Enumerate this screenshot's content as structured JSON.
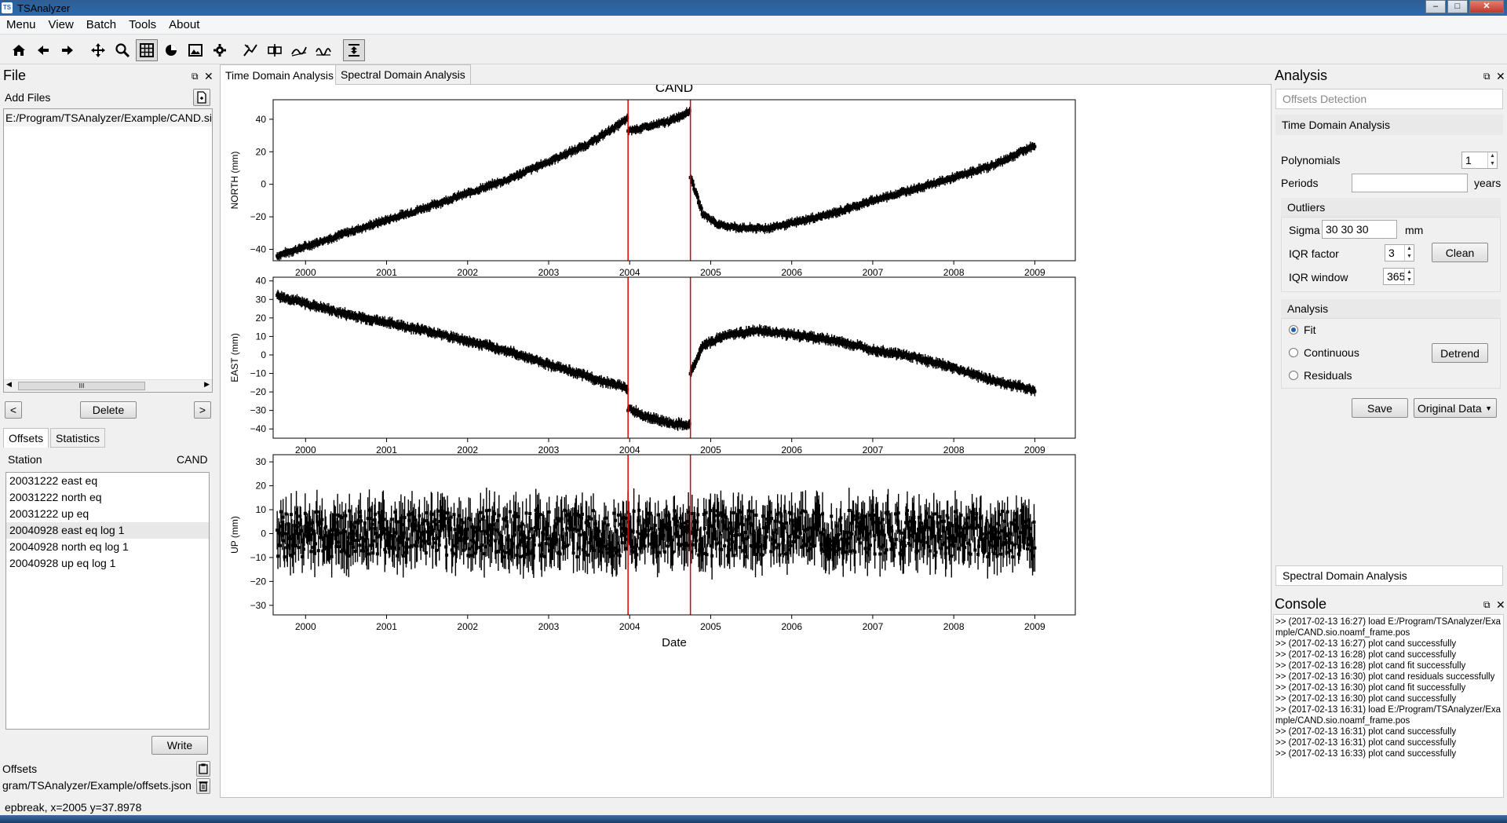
{
  "window": {
    "title": "TSAnalyzer",
    "app_icon": "TS"
  },
  "menubar": [
    "Menu",
    "View",
    "Batch",
    "Tools",
    "About"
  ],
  "toolbar": [
    "home-icon",
    "back-arrow-icon",
    "forward-arrow-icon",
    "pan-icon",
    "zoom-icon",
    "grid-icon",
    "pie-icon",
    "image-icon",
    "gear-icon",
    "remove-outliers-icon",
    "offset-icon",
    "fit-icon",
    "residual-icon",
    "export-icon"
  ],
  "file_panel": {
    "title": "File",
    "add_files_label": "Add Files",
    "file_path": "E:/Program/TSAnalyzer/Example/CAND.sio",
    "scroll_marker": "III",
    "delete_label": "Delete",
    "prev_label": "<",
    "next_label": ">"
  },
  "offsets_panel": {
    "tabs": [
      "Offsets",
      "Statistics"
    ],
    "station_label": "Station",
    "station_value": "CAND",
    "items": [
      "20031222 east eq",
      "20031222 north eq",
      "20031222 up eq",
      "20040928 east eq log 1",
      "20040928 north eq log 1",
      "20040928 up eq log 1"
    ],
    "selected_index": 3,
    "write_label": "Write",
    "offsets_file_label": "Offsets",
    "offsets_file_path": "gram/TSAnalyzer/Example/offsets.json"
  },
  "center": {
    "tabs": [
      "Time Domain Analysis",
      "Spectral Domain Analysis"
    ],
    "active_tab": 0
  },
  "chart_data": [
    {
      "type": "scatter",
      "title": "CAND",
      "ylabel": "NORTH (mm)",
      "xlabel": "",
      "xlim": [
        1999.6,
        2009.5
      ],
      "ylim": [
        -47,
        52
      ],
      "yticks": [
        -40,
        -20,
        0,
        20,
        40
      ],
      "xticks": [
        2000,
        2001,
        2002,
        2003,
        2004,
        2005,
        2006,
        2007,
        2008,
        2009
      ],
      "offset_lines": [
        2003.98,
        2004.75
      ],
      "segments": [
        {
          "x": [
            1999.65,
            2000.5,
            2001.5,
            2002.5,
            2003.5,
            2003.97
          ],
          "y": [
            -44,
            -30,
            -14,
            3,
            25,
            40
          ]
        },
        {
          "x": [
            2003.98,
            2004.2,
            2004.5,
            2004.74
          ],
          "y": [
            33,
            35,
            39,
            45
          ]
        },
        {
          "x": [
            2004.75,
            2004.9,
            2005.1,
            2005.4,
            2005.7,
            2006.0,
            2006.5,
            2007.0,
            2007.5,
            2008.0,
            2008.5,
            2009.0
          ],
          "y": [
            5,
            -18,
            -25,
            -27,
            -27,
            -24,
            -18,
            -10,
            -3,
            4,
            12,
            24
          ]
        }
      ]
    },
    {
      "type": "scatter",
      "title": "",
      "ylabel": "EAST (mm)",
      "xlabel": "",
      "xlim": [
        1999.6,
        2009.5
      ],
      "ylim": [
        -45,
        42
      ],
      "yticks": [
        -40,
        -30,
        -20,
        -10,
        0,
        10,
        20,
        30,
        40
      ],
      "xticks": [
        2000,
        2001,
        2002,
        2003,
        2004,
        2005,
        2006,
        2007,
        2008,
        2009
      ],
      "offset_lines": [
        2003.98,
        2004.75
      ],
      "segments": [
        {
          "x": [
            1999.65,
            2000.5,
            2001.5,
            2002.5,
            2003.5,
            2003.97
          ],
          "y": [
            32,
            22,
            13,
            2,
            -12,
            -18
          ]
        },
        {
          "x": [
            2003.98,
            2004.2,
            2004.5,
            2004.74
          ],
          "y": [
            -29,
            -33,
            -37,
            -38
          ]
        },
        {
          "x": [
            2004.75,
            2004.9,
            2005.2,
            2005.6,
            2006.0,
            2006.5,
            2007.0,
            2007.5,
            2008.0,
            2008.5,
            2009.0
          ],
          "y": [
            -10,
            5,
            11,
            13,
            11,
            8,
            3,
            -1,
            -7,
            -14,
            -19
          ]
        }
      ]
    },
    {
      "type": "scatter",
      "title": "",
      "ylabel": "UP (mm)",
      "xlabel": "Date",
      "xlim": [
        1999.6,
        2009.5
      ],
      "ylim": [
        -34,
        33
      ],
      "yticks": [
        -30,
        -20,
        -10,
        0,
        10,
        20,
        30
      ],
      "xticks": [
        2000,
        2001,
        2002,
        2003,
        2004,
        2005,
        2006,
        2007,
        2008,
        2009
      ],
      "offset_lines": [
        2003.98,
        2004.75
      ],
      "segments": [
        {
          "x": [
            1999.65,
            2009.0
          ],
          "y": [
            0,
            0
          ]
        }
      ],
      "noise_amplitude": 14
    }
  ],
  "analysis_panel": {
    "title": "Analysis",
    "offsets_detection": "Offsets Detection",
    "time_domain_header": "Time Domain Analysis",
    "polynomials_label": "Polynomials",
    "polynomials_value": "1",
    "periods_label": "Periods",
    "periods_value": "",
    "periods_unit": "years",
    "outliers_header": "Outliers",
    "sigma_label": "Sigma",
    "sigma_value": "30 30 30",
    "sigma_unit": "mm",
    "iqr_factor_label": "IQR factor",
    "iqr_factor_value": "3",
    "clean_label": "Clean",
    "iqr_window_label": "IQR window",
    "iqr_window_value": "365",
    "analysis_header": "Analysis",
    "radio_fit": "Fit",
    "radio_continuous": "Continuous",
    "radio_residuals": "Residuals",
    "detrend_label": "Detrend",
    "save_label": "Save",
    "data_select": "Original Data",
    "spectral_header": "Spectral Domain Analysis"
  },
  "console": {
    "title": "Console",
    "text": ">> (2017-02-13 16:27) load E:/Program/TSAnalyzer/Example/CAND.sio.noamf_frame.pos\n>> (2017-02-13 16:27) plot cand successfully\n>> (2017-02-13 16:28) plot cand successfully\n>> (2017-02-13 16:28) plot cand fit successfully\n>> (2017-02-13 16:30) plot cand residuals successfully\n>> (2017-02-13 16:30) plot cand fit successfully\n>> (2017-02-13 16:30) plot cand successfully\n>> (2017-02-13 16:31) load E:/Program/TSAnalyzer/Example/CAND.sio.noamf_frame.pos\n>> (2017-02-13 16:31) plot cand successfully\n>> (2017-02-13 16:31) plot cand successfully\n>> (2017-02-13 16:33) plot cand successfully"
  },
  "statusbar": {
    "text": "epbreak, x=2005 y=37.8978"
  },
  "colors": {
    "offset_line": "#e00000",
    "data": "#000000",
    "titlebar": "#2a6ab0"
  }
}
